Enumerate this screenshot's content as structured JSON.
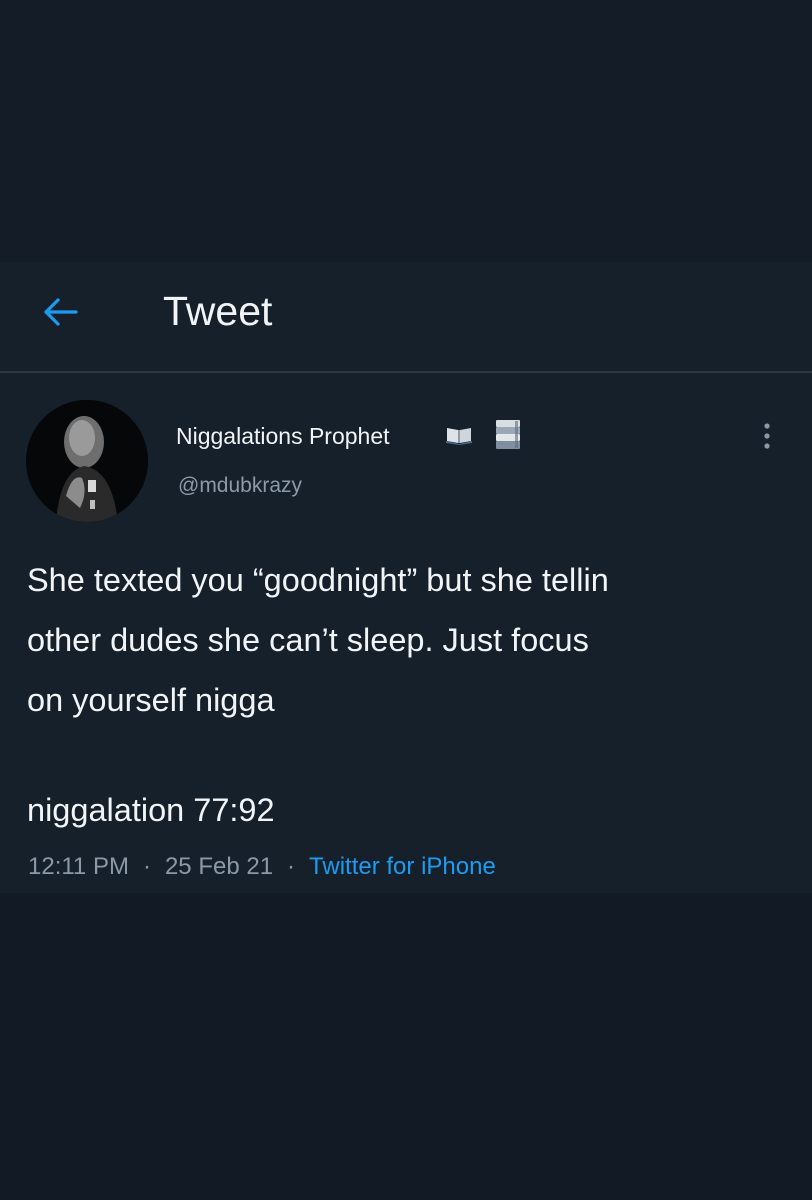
{
  "header": {
    "back_icon": "arrow-left-icon",
    "title": "Tweet",
    "accent_color": "#1d9bf0"
  },
  "tweet": {
    "author": {
      "display_name": "Niggalations Prophet",
      "emojis": [
        "open-book-emoji",
        "books-emoji"
      ],
      "handle": "@mdubkrazy",
      "avatar": "avatar-photo"
    },
    "more_icon": "more-vertical-icon",
    "text_lines": [
      "She texted you “goodnight” but she tellin",
      "other dudes she can’t sleep. Just focus",
      "on yourself nigga"
    ],
    "caption": "niggalation 77:92",
    "time": "12:11 PM",
    "separator": "·",
    "date": "25 Feb 21",
    "source": "Twitter for iPhone"
  }
}
